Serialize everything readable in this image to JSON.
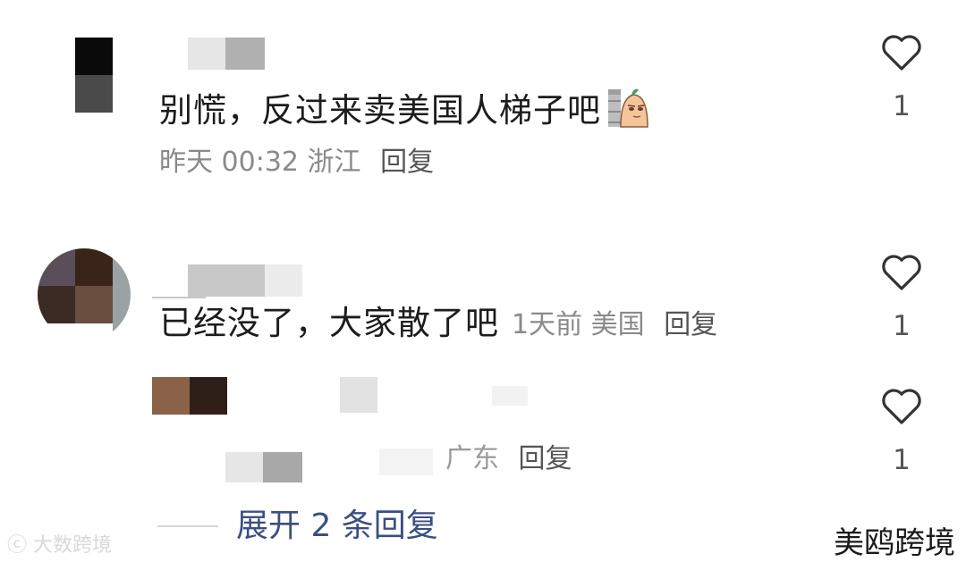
{
  "comments": [
    {
      "text": "别慌，反过来卖美国人梯子吧",
      "time": "昨天 00:32",
      "location": "浙江",
      "reply": "回复",
      "likes": "1",
      "emoji_icon": "peek-wall-emoji"
    },
    {
      "text": "已经没了，大家散了吧",
      "time": "1天前",
      "location": "美国",
      "reply": "回复",
      "likes": "1"
    },
    {
      "location_partial": "广东",
      "reply": "回复",
      "likes": "1"
    }
  ],
  "expand": {
    "label": "展开 2 条回复"
  },
  "watermarks": {
    "left": "大数跨境",
    "right": "美鸥跨境"
  },
  "colors": {
    "link": "#3b4f82",
    "meta": "#8a8a8a",
    "text": "#1c1c1c"
  }
}
